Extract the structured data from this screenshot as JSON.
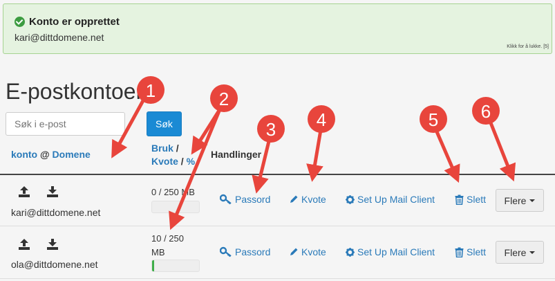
{
  "alert": {
    "title": "Konto er opprettet",
    "email": "kari@dittdomene.net",
    "close_text": "Klikk for å lukke. [5]"
  },
  "page_title": "E-postkontoer",
  "search": {
    "placeholder": "Søk i e-post",
    "button_label": "Søk"
  },
  "table": {
    "headers": {
      "account": "konto",
      "at": "@",
      "domain": "Domene",
      "usage": "Bruk",
      "slash": "/",
      "quota": "Kvote",
      "percent": "%",
      "actions": "Handlinger"
    },
    "rows": [
      {
        "email": "kari@dittdomene.net",
        "usage": "0 / 250 MB",
        "usage_fraction": 0.0
      },
      {
        "email": "ola@dittdomene.net",
        "usage": "10 / 250 MB",
        "usage_fraction": 0.04
      }
    ],
    "actions": {
      "password": "Passord",
      "quota": "Kvote",
      "mail_client": "Set Up Mail Client",
      "delete": "Slett",
      "more": "Flere"
    }
  },
  "annotations": [
    "1",
    "2",
    "3",
    "4",
    "5",
    "6"
  ],
  "colors": {
    "alert_bg": "#e5f3e0",
    "link": "#2a7ab9",
    "primary_button": "#1a8ad4",
    "annotation": "#e8453c",
    "progress": "#3fae49"
  },
  "icons": {
    "success": "check-circle-icon",
    "upload": "upload-icon",
    "download": "download-icon",
    "password": "key-icon",
    "quota": "pencil-icon",
    "mail_client": "gear-icon",
    "delete": "trash-icon",
    "more": "caret-down-icon"
  }
}
